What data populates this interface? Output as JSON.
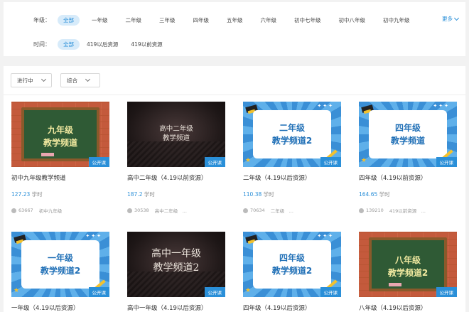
{
  "filters": {
    "grade": {
      "label": "年级：",
      "options": [
        "全部",
        "一年级",
        "二年级",
        "三年级",
        "四年级",
        "五年级",
        "六年级",
        "初中七年级",
        "初中八年级",
        "初中九年级"
      ],
      "selected": "全部"
    },
    "time": {
      "label": "时间：",
      "options": [
        "全部",
        "419以后资源",
        "419以前资源"
      ],
      "selected": "全部"
    },
    "more_label": "更多"
  },
  "toolbar": {
    "status_dropdown": "进行中",
    "sort_dropdown": "综合"
  },
  "colors": {
    "accent": "#2a8fd8",
    "active_bg": "#d7ebfa"
  },
  "hours_unit": "学时",
  "cards": [
    {
      "thumb_style": "chalk",
      "thumb_lines": [
        "九年级",
        "教学频道"
      ],
      "badge": "公开课",
      "title": "初中九年级教学频道",
      "hours": "127.23",
      "views": "63667",
      "tag": "初中九年级"
    },
    {
      "thumb_style": "dark-small",
      "thumb_lines": [
        "高中二年级",
        "教学频道"
      ],
      "badge": "公开课",
      "title": "高中二年级（4.19以前资源）",
      "hours": "187.2",
      "views": "30538",
      "tag": "高中二年级　..."
    },
    {
      "thumb_style": "colorful",
      "thumb_lines": [
        "二年级",
        "教学频道2"
      ],
      "badge": "公开课",
      "title": "二年级（4.19以后资源）",
      "hours": "110.38",
      "views": "70634",
      "tag": "二年级　..."
    },
    {
      "thumb_style": "colorful",
      "thumb_lines": [
        "四年级",
        "教学频道"
      ],
      "badge": "公开课",
      "title": "四年级（4.19以前资源）",
      "hours": "164.65",
      "views": "139210",
      "tag": "419以前资源　..."
    },
    {
      "thumb_style": "colorful",
      "thumb_lines": [
        "一年级",
        "教学频道2"
      ],
      "badge": "公开课",
      "title": "一年级（4.19以后资源）"
    },
    {
      "thumb_style": "dark-big",
      "thumb_lines": [
        "高中一年级",
        "教学频道2"
      ],
      "badge": "公开课",
      "title": "高中一年级（4.19以后资源）"
    },
    {
      "thumb_style": "colorful",
      "thumb_lines": [
        "四年级",
        "教学频道2"
      ],
      "badge": "公开课",
      "title": "四年级（4.19以后资源）"
    },
    {
      "thumb_style": "chalk",
      "thumb_lines": [
        "八年级",
        "教学频道2"
      ],
      "badge": "公开课",
      "title": "八年级（4.19以后资源）"
    }
  ]
}
